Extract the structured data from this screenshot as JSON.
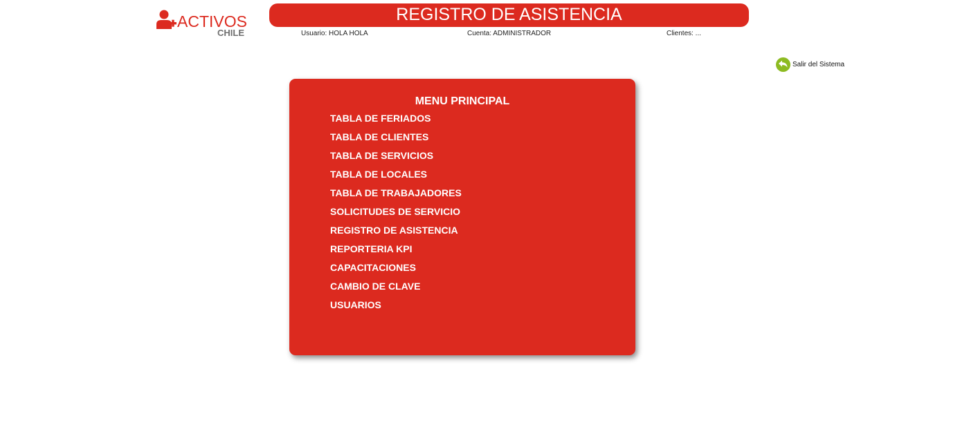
{
  "header": {
    "logo": {
      "word": "ACTIVOS",
      "sub": "CHILE",
      "icon": "user-plus-icon",
      "color": "#dc2a1f"
    },
    "title": "REGISTRO DE ASISTENCIA",
    "user": "Usuario: HOLA HOLA",
    "account": "Cuenta: ADMINISTRADOR",
    "clients": "Clientes: ..."
  },
  "logout": {
    "label": "Salir del Sistema",
    "icon": "back-arrow-icon",
    "icon_color": "#8dbb22"
  },
  "menu": {
    "title": "MENU PRINCIPAL",
    "items": [
      "TABLA DE FERIADOS",
      "TABLA DE CLIENTES",
      "TABLA DE SERVICIOS",
      "TABLA DE LOCALES",
      "TABLA DE TRABAJADORES",
      "SOLICITUDES DE SERVICIO",
      "REGISTRO DE ASISTENCIA",
      "REPORTERIA KPI",
      "CAPACITACIONES",
      "CAMBIO DE CLAVE",
      "USUARIOS"
    ],
    "background": "#dc2a1f"
  }
}
